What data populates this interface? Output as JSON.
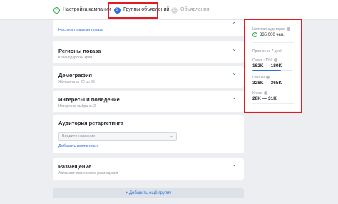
{
  "steps": [
    {
      "label": "Настройка кампании",
      "state": "done",
      "marker": "✓"
    },
    {
      "label": "Группы объявлений",
      "state": "active",
      "marker": "2"
    },
    {
      "label": "Объявления",
      "state": "todo",
      "marker": "3"
    }
  ],
  "schedule_link": "Настроить время показа",
  "sections": {
    "regions": {
      "title": "Регионы показа",
      "subtitle": "Краснодарский край"
    },
    "demography": {
      "title": "Демография",
      "subtitle": "Женщины от 20 до 63"
    },
    "interests": {
      "title": "Интересы и поведение",
      "subtitle": "Интересов выбрано: 2"
    },
    "retargeting": {
      "title": "Аудитория ретаргетинга",
      "select_placeholder": "Введите название",
      "exclude_link": "Добавить исключение"
    },
    "placement": {
      "title": "Размещение",
      "subtitle": "Автоматические места размещения"
    }
  },
  "add_group": "+ Добавить ещё группу",
  "sidebar": {
    "audience_label": "Целевая аудитория",
    "audience_value": "335 000 чел.",
    "forecast_label": "Прогноз за 7 дней",
    "reach_label": "Охват ~11%",
    "reach_value": "162K — 180K",
    "reach_fill": 0.72,
    "impressions_label": "Показы",
    "impressions_value": "328K — 365K",
    "clicks_label": "Клики",
    "clicks_value": "28K — 31K"
  },
  "colors": {
    "accent": "#2c6fd6",
    "highlight": "#e01b22",
    "success": "#2fa84f"
  }
}
